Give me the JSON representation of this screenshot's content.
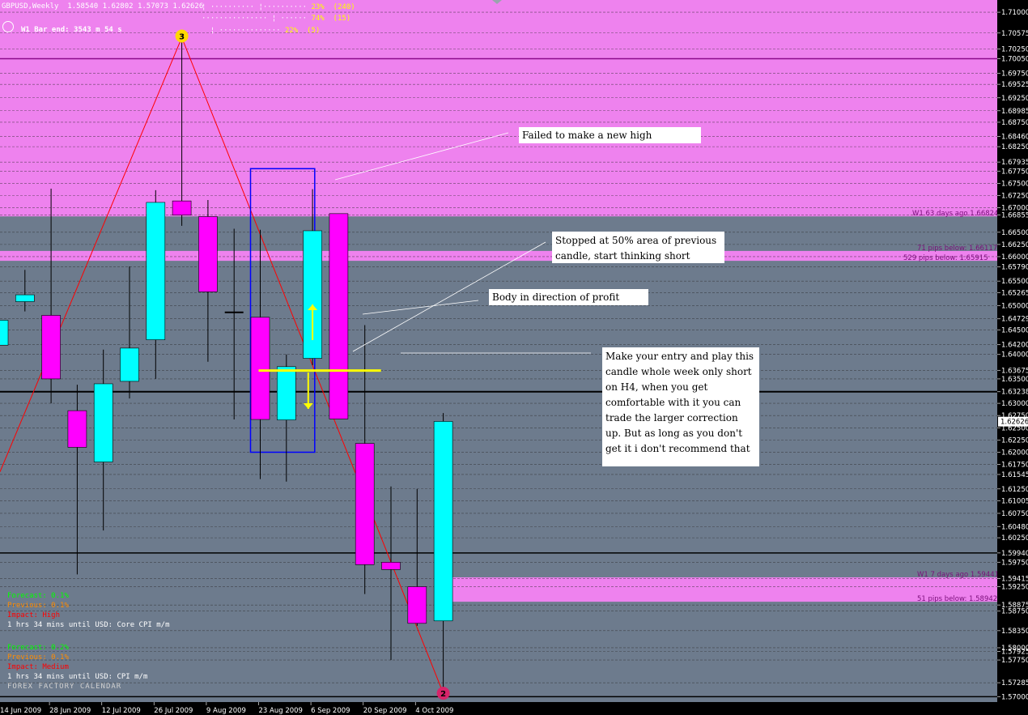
{
  "header": {
    "title": "GBPUSD,Weekly  1.58540 1.62802 1.57073 1.62626",
    "bar_end": "W1 Bar end: 3543 m 54 s",
    "stats": [
      "23%  (240)",
      "74%  (15)",
      "22%  (5)"
    ]
  },
  "colors": {
    "background": "#6d7b8d",
    "zone": "#ee82ee",
    "bull": "#00ffff",
    "bear": "#ff00ff",
    "zigzag": "#ff0000",
    "entry_line": "#ffff00",
    "box": "#0000ff"
  },
  "chart_data": {
    "type": "candlestick",
    "symbol": "GBPUSD",
    "timeframe": "Weekly",
    "ylim": [
      1.5689,
      1.7125
    ],
    "x_tick_labels": [
      "14 Jun 2009",
      "28 Jun 2009",
      "12 Jul 2009",
      "26 Jul 2009",
      "9 Aug 2009",
      "23 Aug 2009",
      "6 Sep 2009",
      "20 Sep 2009",
      "4 Oct 2009"
    ],
    "y_tick_labels": [
      "1.71000",
      "1.70575",
      "1.70250",
      "1.70050",
      "1.69750",
      "1.69525",
      "1.69250",
      "1.68985",
      "1.68750",
      "1.68460",
      "1.68250",
      "1.67935",
      "1.67750",
      "1.67500",
      "1.67250",
      "1.67000",
      "1.66855",
      "1.66500",
      "1.66250",
      "1.66000",
      "1.65790",
      "1.65500",
      "1.65265",
      "1.65000",
      "1.64729",
      "1.64500",
      "1.64200",
      "1.64000",
      "1.63675",
      "1.63500",
      "1.63238",
      "1.63000",
      "1.62750",
      "1.62500",
      "1.62250",
      "1.62000",
      "1.61750",
      "1.61545",
      "1.61250",
      "1.61005",
      "1.60750",
      "1.60480",
      "1.60250",
      "1.59940",
      "1.59750",
      "1.59415",
      "1.59250",
      "1.58875",
      "1.58750",
      "1.58350",
      "1.58000",
      "1.57925",
      "1.57750",
      "1.57285",
      "1.57000"
    ],
    "current_price": "1.62626",
    "candles": [
      {
        "open": 1.6419,
        "high": 1.6478,
        "low": 1.6396,
        "close": 1.647
      },
      {
        "open": 1.6508,
        "high": 1.6573,
        "low": 1.6488,
        "close": 1.6522
      },
      {
        "open": 1.648,
        "high": 1.6739,
        "low": 1.63,
        "close": 1.635
      },
      {
        "open": 1.6285,
        "high": 1.6338,
        "low": 1.595,
        "close": 1.621
      },
      {
        "open": 1.618,
        "high": 1.641,
        "low": 1.604,
        "close": 1.634
      },
      {
        "open": 1.6345,
        "high": 1.658,
        "low": 1.631,
        "close": 1.6413
      },
      {
        "open": 1.643,
        "high": 1.6736,
        "low": 1.635,
        "close": 1.6711
      },
      {
        "open": 1.6714,
        "high": 1.7048,
        "low": 1.6663,
        "close": 1.6685
      },
      {
        "open": 1.6682,
        "high": 1.6716,
        "low": 1.6385,
        "close": 1.6528
      },
      {
        "open": 1.6486,
        "high": 1.6657,
        "low": 1.6267,
        "close": 1.6486
      },
      {
        "open": 1.6476,
        "high": 1.6655,
        "low": 1.6145,
        "close": 1.6267
      },
      {
        "open": 1.6266,
        "high": 1.64,
        "low": 1.614,
        "close": 1.6375
      },
      {
        "open": 1.6392,
        "high": 1.6738,
        "low": 1.6378,
        "close": 1.6653
      },
      {
        "open": 1.6688,
        "high": 1.6688,
        "low": 1.6268,
        "close": 1.6268
      },
      {
        "open": 1.6218,
        "high": 1.646,
        "low": 1.591,
        "close": 1.597
      },
      {
        "open": 1.5975,
        "high": 1.613,
        "low": 1.5775,
        "close": 1.596
      },
      {
        "open": 1.5925,
        "high": 1.6125,
        "low": 1.5845,
        "close": 1.585
      },
      {
        "open": 1.5855,
        "high": 1.628,
        "low": 1.5707,
        "close": 1.6263
      }
    ],
    "zones": [
      {
        "label": "W1 63 days ago 1.66824",
        "from": 1.66824,
        "to": 1.7125
      },
      {
        "label": "71 pips below: 1.66117",
        "from": 1.65915,
        "to": 1.66117
      },
      {
        "label": "529 pips below: 1.65915",
        "from": 1.65915,
        "to": 1.66117
      },
      {
        "label": "W1 7 days ago 1.59441",
        "from": 1.58942,
        "to": 1.59441
      },
      {
        "label": "51 pips below: 1.58942",
        "from": 1.58942,
        "to": 1.59441
      }
    ],
    "horizontal_levels": [
      1.7005,
      1.63238,
      1.5994,
      1.57
    ],
    "zigzag_points": [
      {
        "label": "3",
        "candle": 7,
        "price": 1.7048
      },
      {
        "label": "2",
        "candle": 17,
        "price": 1.5707
      }
    ]
  },
  "annotations": [
    {
      "id": "failed-high",
      "text": "Failed to make a new high"
    },
    {
      "id": "stopped-50",
      "text": "Stopped at 50% area of previous candle, start thinking short"
    },
    {
      "id": "body-direction",
      "text": "Body in direction of profit"
    },
    {
      "id": "entry",
      "text": "Make your entry and play this candle whole week only short on H4, when you get comfortable with it you can trade the larger correction up.  But as long as you don't get it i don't recommend that"
    }
  ],
  "news": [
    {
      "forecast": "Forecast: 0.1%",
      "previous": "Previous: 0.1%",
      "impact": "Impact: High",
      "event": "1 hrs 34 mins until USD: Core CPI m/m"
    },
    {
      "forecast": "Forecast: 0.2%",
      "previous": "Previous: 0.1%",
      "impact": "Impact: Medium",
      "event": "1 hrs 34 mins until USD: CPI m/m"
    }
  ],
  "footer": "FOREX FACTORY CALENDAR"
}
